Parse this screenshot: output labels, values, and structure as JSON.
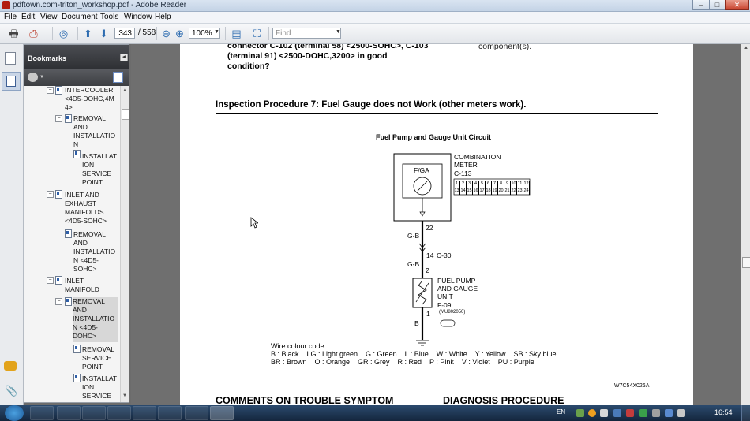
{
  "window": {
    "title": "pdftown.com-triton_workshop.pdf - Adobe Reader",
    "controls": [
      "–",
      "□",
      "✕"
    ]
  },
  "menu": [
    "File",
    "Edit",
    "View",
    "Document",
    "Tools",
    "Window",
    "Help"
  ],
  "toolbar": {
    "page_current": "343",
    "page_total": "/ 558",
    "zoom": "100%",
    "find_placeholder": "Find"
  },
  "bookmarks": {
    "header": "Bookmarks",
    "items": [
      {
        "label": "INTERCOOLER <4D5-DOHC,4M 4>"
      },
      {
        "label": "REMOVAL AND INSTALLATIO N"
      },
      {
        "label": "INSTALLAT ION SERVICE POINT"
      },
      {
        "label": "INLET AND EXHAUST MANIFOLDS <4D5-SOHC>"
      },
      {
        "label": "REMOVAL AND INSTALLATIO N <4D5-SOHC>"
      },
      {
        "label": "INLET MANIFOLD"
      },
      {
        "label": "REMOVAL AND INSTALLATIO N <4D5-DOHC>"
      },
      {
        "label": "REMOVAL SERVICE POINT"
      },
      {
        "label": "INSTALLAT ION SERVICE"
      }
    ]
  },
  "document": {
    "top_left_line1": "connector C-102 (terminal 58) <2500-SOHC>, C-103",
    "top_left_line2": "(terminal 91) <2500-DOHC,3200> in good",
    "top_left_line3": "condition?",
    "top_right": "component(s).",
    "section_heading": "Inspection Procedure 7: Fuel Gauge does not Work (other meters work).",
    "diagram": {
      "title": "Fuel Pump and Gauge Unit Circuit",
      "meter_label_1": "COMBINATION",
      "meter_label_2": "METER",
      "meter_connector": "C-113",
      "gauge_label": "F/GA",
      "connector_row1": [
        "1",
        "2",
        "3",
        "4",
        "5",
        "6",
        "7",
        "8",
        "9",
        "10",
        "11",
        "12"
      ],
      "connector_row2": [
        "13",
        "14",
        "15",
        "16",
        "17",
        "18",
        "19",
        "20",
        "21",
        "22",
        "23",
        "24"
      ],
      "pin_22": "22",
      "wire_1": "G-B",
      "wire_2": "G-B",
      "pin_14": "14",
      "conn_c30": "C-30",
      "pin_2": "2",
      "pump_label_1": "FUEL PUMP",
      "pump_label_2": "AND GAUGE",
      "pump_label_3": "UNIT",
      "pump_connector": "F-09",
      "part_number": "(MU802050)",
      "pin_1": "1",
      "wire_3": "B",
      "figure_code": "W7C54X026A"
    },
    "wire_colour_title": "Wire colour code",
    "wire_colour_line1": "B : Black    LG : Light green    G : Green    L : Blue    W : White    Y : Yellow    SB : Sky blue",
    "wire_colour_line2": "BR : Brown    O : Orange    GR : Grey    R : Red    P : Pink    V : Violet    PU : Purple",
    "bottom_left": "COMMENTS ON TROUBLE SYMPTOM",
    "bottom_right": "DIAGNOSIS PROCEDURE"
  },
  "taskbar": {
    "lang": "EN",
    "time": "16:54"
  }
}
